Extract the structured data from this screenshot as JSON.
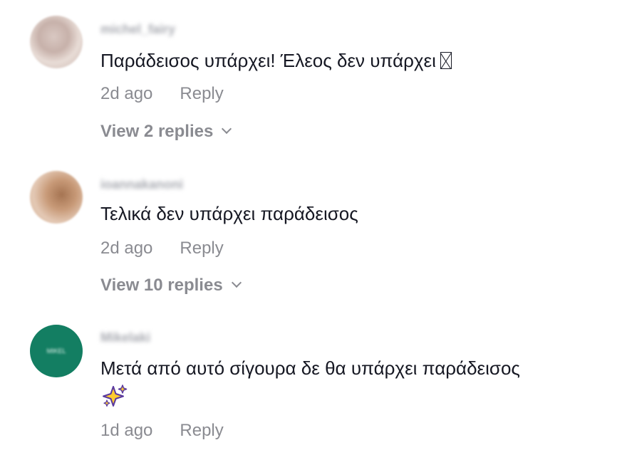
{
  "comments": [
    {
      "username": "michel_fairy",
      "text": "Παράδεισος υπάρχει! Έλεος δεν υπάρχει",
      "time": "2d ago",
      "reply_label": "Reply",
      "view_replies": "View 2 replies"
    },
    {
      "username": "ioannakanoni",
      "text": "Τελικά δεν υπάρχει παράδεισος",
      "time": "2d ago",
      "reply_label": "Reply",
      "view_replies": "View 10 replies"
    },
    {
      "username": "Mikelaki",
      "text": "Μετά από αυτό σίγουρα δε θα υπάρχει παράδεισος",
      "emoji": "sparkles-icon",
      "time": "1d ago",
      "reply_label": "Reply",
      "avatar_text": "MIKEL"
    }
  ],
  "colors": {
    "text": "#161823",
    "muted": "#8a8b91",
    "avatar_green": "#137e62"
  }
}
